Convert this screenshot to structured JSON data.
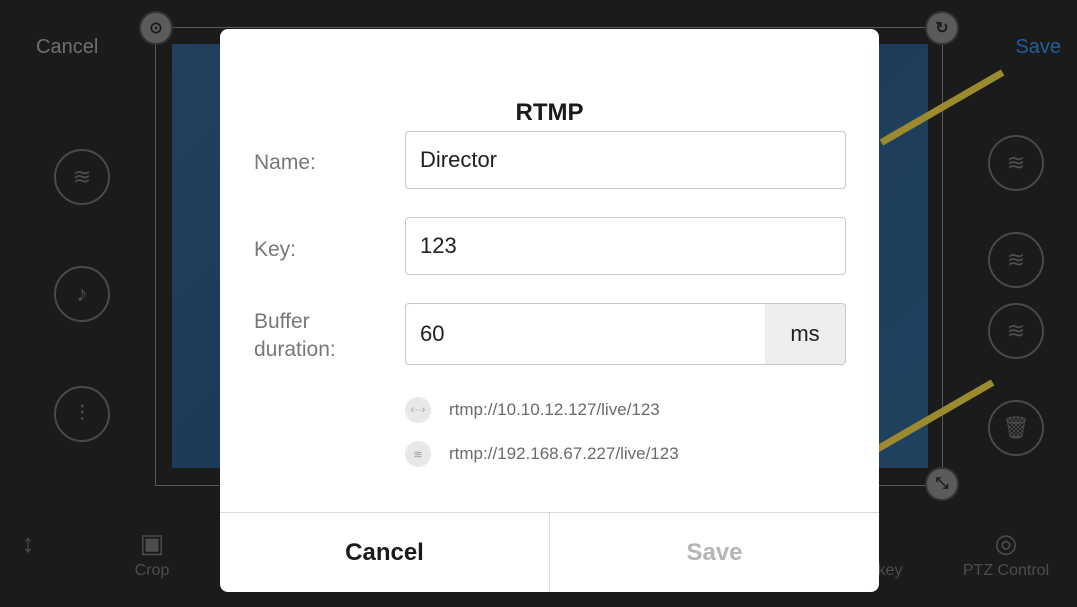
{
  "topbar": {
    "cancel_label": "Cancel",
    "save_label": "Save"
  },
  "bottom_toolbar": {
    "crop_label": "Crop",
    "key_label": "key",
    "ptz_label": "PTZ Control"
  },
  "dialog": {
    "title": "RTMP",
    "name_label": "Name:",
    "name_value": "Director",
    "key_label": "Key:",
    "key_value": "123",
    "buffer_label_line1": "Buffer",
    "buffer_label_line2": "duration:",
    "buffer_value": "60",
    "buffer_unit": "ms",
    "urls": [
      {
        "icon": "ethernet-icon",
        "text": "rtmp://10.10.12.127/live/123"
      },
      {
        "icon": "wifi-icon",
        "text": "rtmp://192.168.67.227/live/123"
      }
    ],
    "cancel_label": "Cancel",
    "save_label": "Save"
  },
  "colors": {
    "accent": "#1f5f9a",
    "dim_text": "#6f6f6f",
    "disabled": "#b5b5b5"
  }
}
